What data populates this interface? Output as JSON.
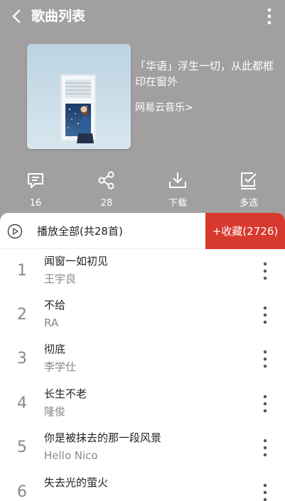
{
  "header": {
    "title": "歌曲列表"
  },
  "playlist": {
    "name": "「华语」浮生一切，从此都框印在窗外",
    "creator": "网易云音乐>"
  },
  "actions": [
    {
      "icon": "comment-icon",
      "label": "16"
    },
    {
      "icon": "share-icon",
      "label": "28"
    },
    {
      "icon": "download-icon",
      "label": "下载"
    },
    {
      "icon": "multi-select-icon",
      "label": "多选"
    }
  ],
  "play_all": {
    "label": "播放全部(共28首)",
    "collect_label": "+收藏(2726)"
  },
  "songs": [
    {
      "index": "1",
      "title": "闻窗一如初见",
      "artist": "王宇良"
    },
    {
      "index": "2",
      "title": "不给",
      "artist": "RA"
    },
    {
      "index": "3",
      "title": "彻底",
      "artist": "李学仕"
    },
    {
      "index": "4",
      "title": "长生不老",
      "artist": "隆俊"
    },
    {
      "index": "5",
      "title": "你是被抹去的那一段风景",
      "artist": "Hello Nico"
    },
    {
      "index": "6",
      "title": "失去光的萤火",
      "artist": ""
    }
  ],
  "colors": {
    "header_bg": "#a29fa0",
    "accent": "#d8392f"
  }
}
